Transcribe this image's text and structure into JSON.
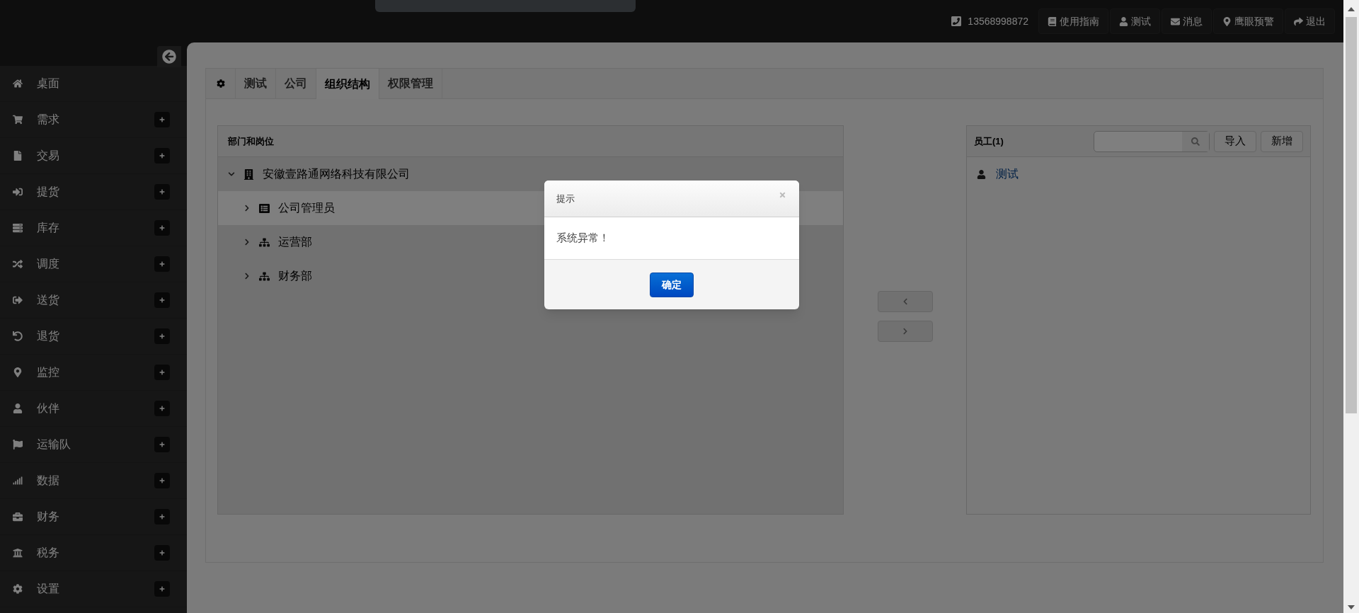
{
  "topbar": {
    "phone": "13568998872",
    "links": [
      "使用指南",
      "测试",
      "消息",
      "鹰眼预警",
      "退出"
    ]
  },
  "sidebar": {
    "items": [
      {
        "label": "桌面",
        "expandable": false
      },
      {
        "label": "需求",
        "expandable": true
      },
      {
        "label": "交易",
        "expandable": true
      },
      {
        "label": "提货",
        "expandable": true
      },
      {
        "label": "库存",
        "expandable": true
      },
      {
        "label": "调度",
        "expandable": true
      },
      {
        "label": "送货",
        "expandable": true
      },
      {
        "label": "退货",
        "expandable": true
      },
      {
        "label": "监控",
        "expandable": true
      },
      {
        "label": "伙伴",
        "expandable": true
      },
      {
        "label": "运输队",
        "expandable": true
      },
      {
        "label": "数据",
        "expandable": true
      },
      {
        "label": "财务",
        "expandable": true
      },
      {
        "label": "税务",
        "expandable": true
      },
      {
        "label": "设置",
        "expandable": true
      }
    ]
  },
  "tabs": [
    {
      "label": "测试",
      "selected": false
    },
    {
      "label": "公司",
      "selected": false
    },
    {
      "label": "组织结构",
      "selected": true
    },
    {
      "label": "权限管理",
      "selected": false
    }
  ],
  "departments": {
    "title": "部门和岗位",
    "tree": [
      {
        "kind": "company",
        "label": "安徽壹路通网络科技有限公司",
        "expanded": true,
        "selected": false,
        "children": [
          {
            "kind": "role",
            "label": "公司管理员",
            "expanded": false,
            "selected": true
          },
          {
            "kind": "department",
            "label": "运营部",
            "expanded": false,
            "selected": false
          },
          {
            "kind": "department",
            "label": "财务部",
            "expanded": false,
            "selected": false
          }
        ]
      }
    ]
  },
  "employees": {
    "title": "员工(1)",
    "buttons": [
      "导入",
      "新增"
    ],
    "list": [
      {
        "name": "测试"
      }
    ]
  },
  "dialog": {
    "title": "提示",
    "message": "系统异常！",
    "button": "确定"
  }
}
